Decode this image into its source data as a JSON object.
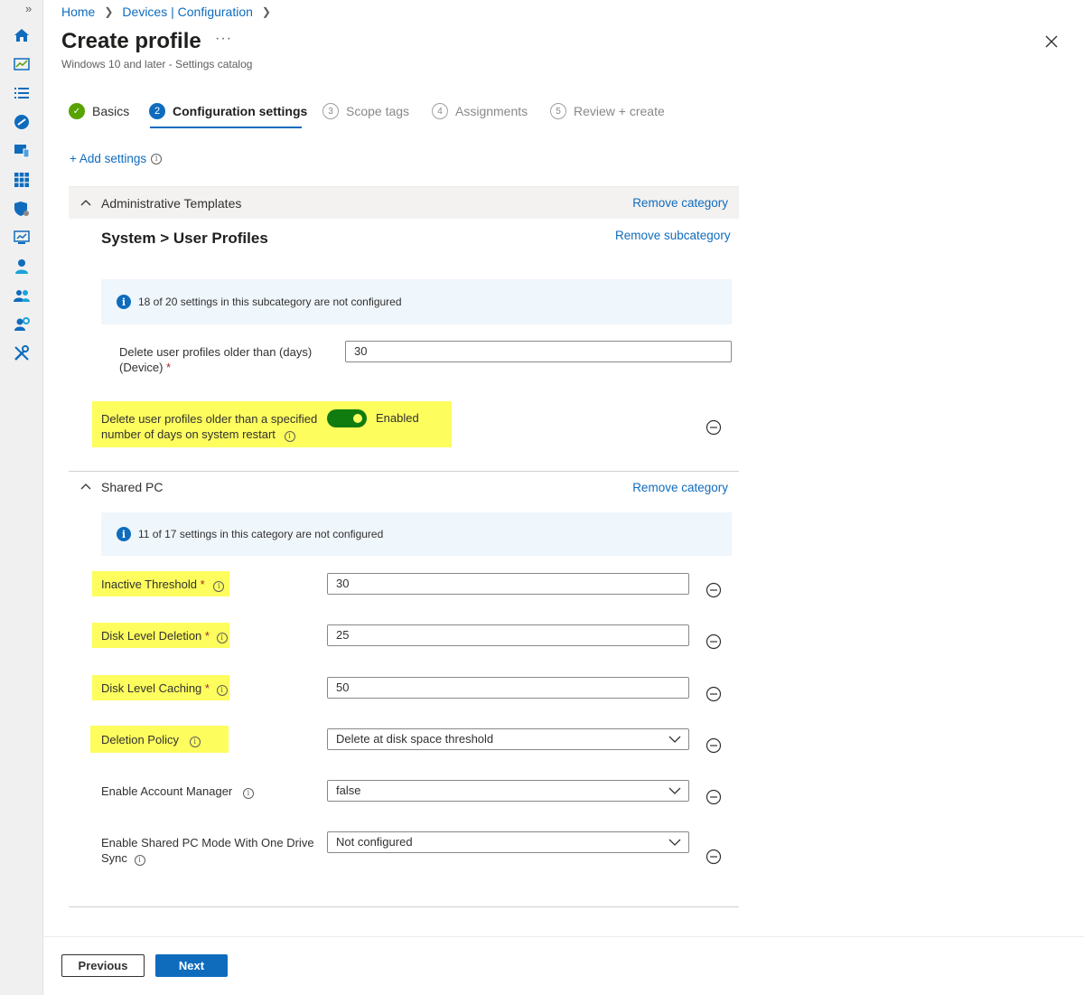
{
  "breadcrumb": {
    "home": "Home",
    "section": "Devices | Configuration"
  },
  "page": {
    "title": "Create profile",
    "more": "···",
    "subtitle": "Windows 10 and later - Settings catalog"
  },
  "steps": [
    {
      "number": "✓",
      "label": "Basics"
    },
    {
      "number": "2",
      "label": "Configuration settings"
    },
    {
      "number": "3",
      "label": "Scope tags"
    },
    {
      "number": "4",
      "label": "Assignments"
    },
    {
      "number": "5",
      "label": "Review + create"
    }
  ],
  "add_settings": "+ Add settings",
  "category1": {
    "name": "Administrative Templates",
    "remove": "Remove category",
    "sub_part1": "System",
    "sub_sep": ">",
    "sub_part2": "User Profiles",
    "remove_sub": "Remove subcategory",
    "info": "18 of 20 settings in this subcategory are not configured",
    "setting1_label_line1": "Delete user profiles older than (days)",
    "setting1_label_line2": "(Device)",
    "setting1_value": "30",
    "setting2_label_line1": "Delete user profiles older than a specified",
    "setting2_label_line2": "number of days on system restart",
    "setting2_toggle": "Enabled"
  },
  "category2": {
    "name": "Shared PC",
    "remove": "Remove category",
    "info": "11 of 17 settings in this category are not configured",
    "settings": [
      {
        "label": "Inactive Threshold",
        "value": "30"
      },
      {
        "label": "Disk Level Deletion",
        "value": "25"
      },
      {
        "label": "Disk Level Caching",
        "value": "50"
      },
      {
        "label": "Deletion Policy",
        "value": "Delete at disk space threshold"
      },
      {
        "label": "Enable Account Manager",
        "value": "false"
      },
      {
        "label_line1": "Enable Shared PC Mode With One Drive",
        "label_line2": "Sync",
        "value": "Not configured"
      }
    ],
    "required_mark": "*"
  },
  "buttons": {
    "previous": "Previous",
    "next": "Next"
  },
  "colors": {
    "accent": "#0f6cbd",
    "highlight": "#fdfd5e",
    "toggle_on": "#107c10",
    "done": "#57a300"
  }
}
